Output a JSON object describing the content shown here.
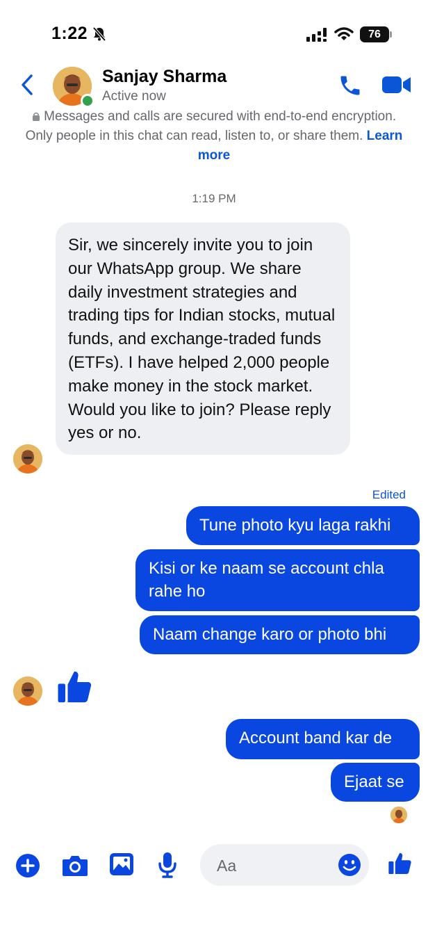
{
  "status_bar": {
    "time": "1:22",
    "battery": "76"
  },
  "header": {
    "name": "Sanjay Sharma",
    "status": "Active now"
  },
  "encryption": {
    "text": "Messages and calls are secured with end-to-end encryption. Only people in this chat can read, listen to, or share them.",
    "link": "Learn more"
  },
  "timestamp": "1:19 PM",
  "incoming_message": "Sir, we sincerely invite you to join our WhatsApp group. We share daily investment strategies and trading tips for Indian stocks, mutual funds, and exchange-traded funds (ETFs). I have helped 2,000 people make money in the stock market. Would you like to join? Please reply yes or no.",
  "edited_label": "Edited",
  "outgoing_messages": [
    "Tune photo kyu laga rakhi",
    "Kisi or ke naam se account chla rahe ho",
    "Naam change karo or photo bhi",
    "Account band kar de",
    "Ejaat se"
  ],
  "composer": {
    "placeholder": "Aa"
  },
  "colors": {
    "accent": "#0a46e0",
    "link": "#0a56d6",
    "incoming_bubble": "#eeeff2",
    "online": "#31a24c"
  },
  "icons": [
    "back-icon",
    "phone-icon",
    "video-icon",
    "plus-icon",
    "camera-icon",
    "image-icon",
    "microphone-icon",
    "emoji-icon",
    "thumbs-up-icon",
    "lock-icon"
  ]
}
